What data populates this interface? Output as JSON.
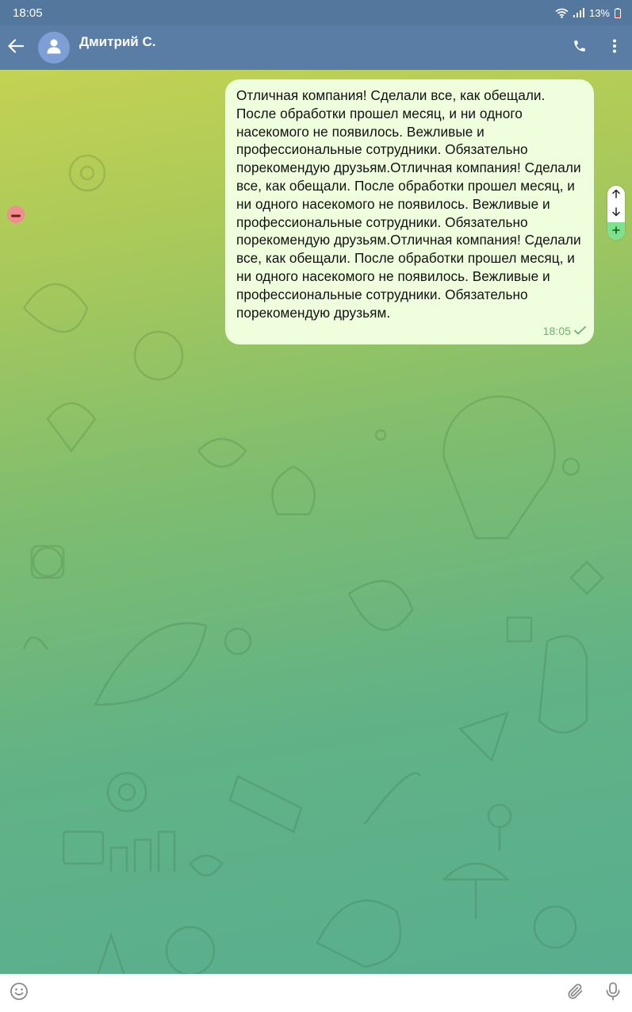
{
  "status": {
    "time": "18:05",
    "battery": "13%",
    "icons": [
      "wifi-icon",
      "signal-icon",
      "battery-icon"
    ]
  },
  "header": {
    "contact_name": "Дмитрий С.",
    "icons": [
      "back-arrow-icon",
      "user-avatar-icon",
      "phone-icon",
      "more-vertical-icon"
    ]
  },
  "message": {
    "text": "Отличная компания! Сделали все, как обещали. После обработки прошел месяц, и ни одного насекомого не появилось. Вежливые и профессиональные сотрудники. Обязательно порекомендую друзьям.Отличная компания! Сделали все, как обещали. После обработки прошел месяц, и ни одного насекомого не появилось. Вежливые и профессиональные сотрудники. Обязательно порекомендую друзьям.Отличная компания! Сделали все, как обещали. После обработки прошел месяц, и ни одного насекомого не появилось. Вежливые и профессиональные сотрудники. Обязательно порекомендую друзьям.",
    "time": "18:05",
    "status_icon": "check-icon"
  },
  "overlay_controls": {
    "icons": [
      "minus-icon",
      "arrow-up-icon",
      "arrow-down-icon",
      "plus-icon"
    ]
  },
  "input": {
    "placeholder": "",
    "value": "",
    "icons": [
      "emoji-icon",
      "attach-icon",
      "mic-icon"
    ]
  },
  "colors": {
    "header_bg": "#5a7da6",
    "status_bg": "#54779e",
    "bubble_bg": "#effedd",
    "check_color": "#6ab26e",
    "remove_dot": "#ee8e8e",
    "plus_green": "#7fe08f"
  }
}
